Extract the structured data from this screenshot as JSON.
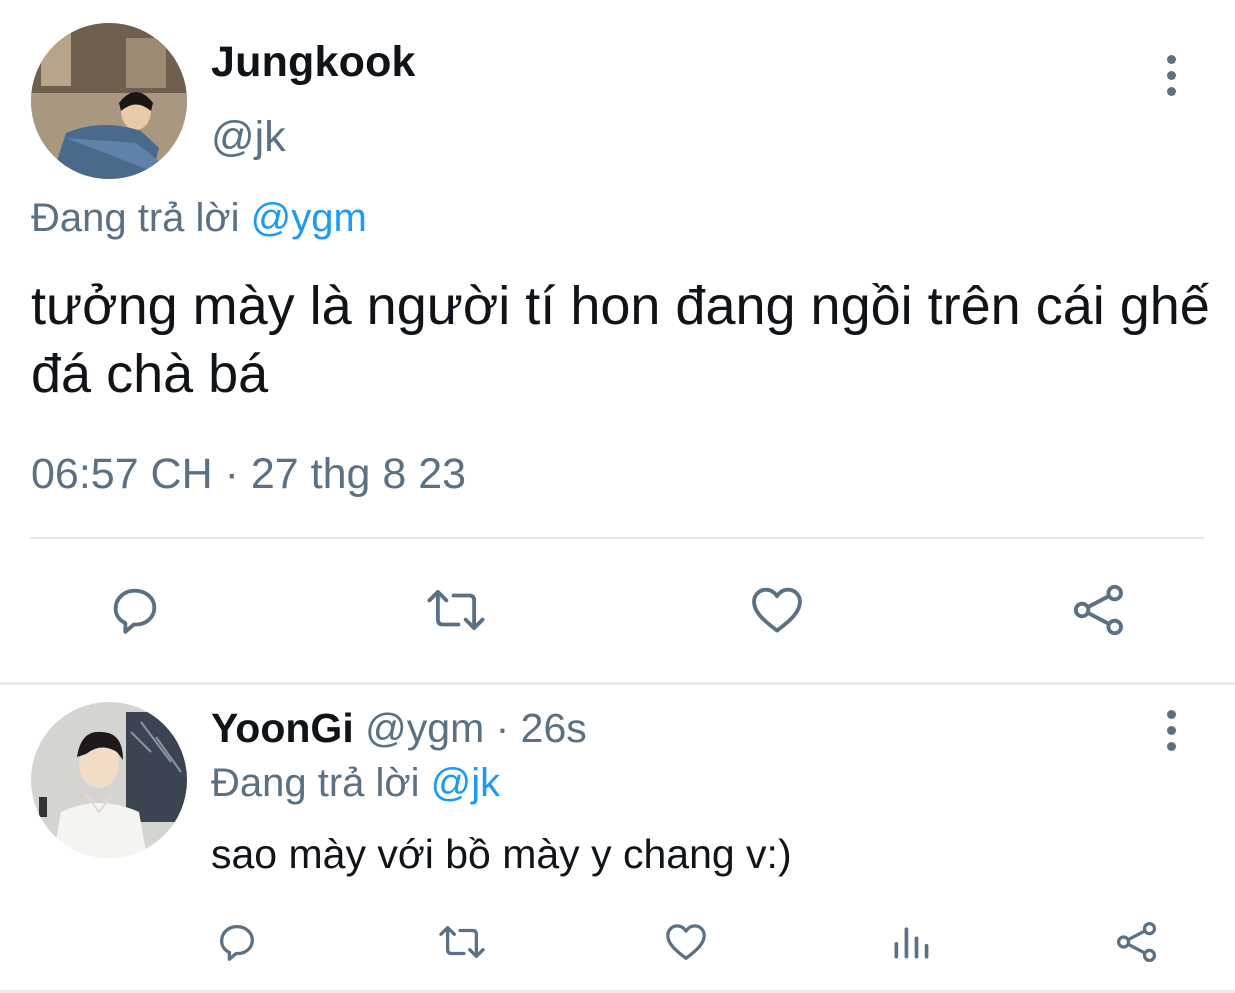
{
  "main_tweet": {
    "author": {
      "display_name": "Jungkook",
      "handle": "@jk"
    },
    "replying_to": {
      "prefix": "Đang trả lời",
      "mention": "@ygm"
    },
    "text": "tưởng mày là người tí hon đang ngồi trên cái ghế đá chà bá",
    "timestamp": "06:57 CH · 27 thg 8 23",
    "actions": [
      "reply-icon",
      "retweet-icon",
      "like-icon",
      "share-icon"
    ]
  },
  "reply_tweet": {
    "author": {
      "display_name": "YoonGi",
      "handle": "@ygm"
    },
    "time_meta": "· 26s",
    "replying_to": {
      "prefix": "Đang trả lời",
      "mention": "@jk"
    },
    "text": "sao mày với bồ mày y chang v:)",
    "actions": [
      "reply-icon",
      "retweet-icon",
      "like-icon",
      "analytics-icon",
      "share-icon"
    ]
  },
  "colors": {
    "text_primary": "#0f1419",
    "text_secondary": "#5b7083",
    "link": "#1d9bf0",
    "divider": "#e1e8ed"
  }
}
